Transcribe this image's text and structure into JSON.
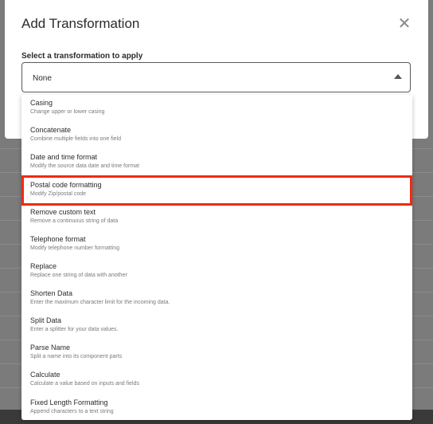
{
  "dialog": {
    "title": "Add Transformation",
    "close_icon": "close-icon",
    "field_label": "Select a transformation to apply",
    "select": {
      "value": "None",
      "caret_icon": "caret-up-icon"
    }
  },
  "options": [
    {
      "title": "Casing",
      "description": "Change upper or lower casing"
    },
    {
      "title": "Concatenate",
      "description": "Combine multiple fields into one field"
    },
    {
      "title": "Date and time format",
      "description": "Modify the source data date and time format"
    },
    {
      "title": "Postal code formatting",
      "description": "Modify Zip/postal code"
    },
    {
      "title": "Remove custom text",
      "description": "Remove a continuous string of data"
    },
    {
      "title": "Telephone format",
      "description": "Modify telephone number formatting"
    },
    {
      "title": "Replace",
      "description": "Replace one string of data with another"
    },
    {
      "title": "Shorten Data",
      "description": "Enter the maximum character limit for the incoming data."
    },
    {
      "title": "Split Data",
      "description": "Enter a splitter for your data values."
    },
    {
      "title": "Parse Name",
      "description": "Split a name into its component parts"
    },
    {
      "title": "Calculate",
      "description": "Calculate a value based on inputs and fields"
    },
    {
      "title": "Fixed Length Formatting",
      "description": "Append characters to a text string"
    }
  ],
  "highlighted_option": "Postal code formatting",
  "colors": {
    "highlight": "#f12a12",
    "overlay": "#7b7b7b"
  }
}
